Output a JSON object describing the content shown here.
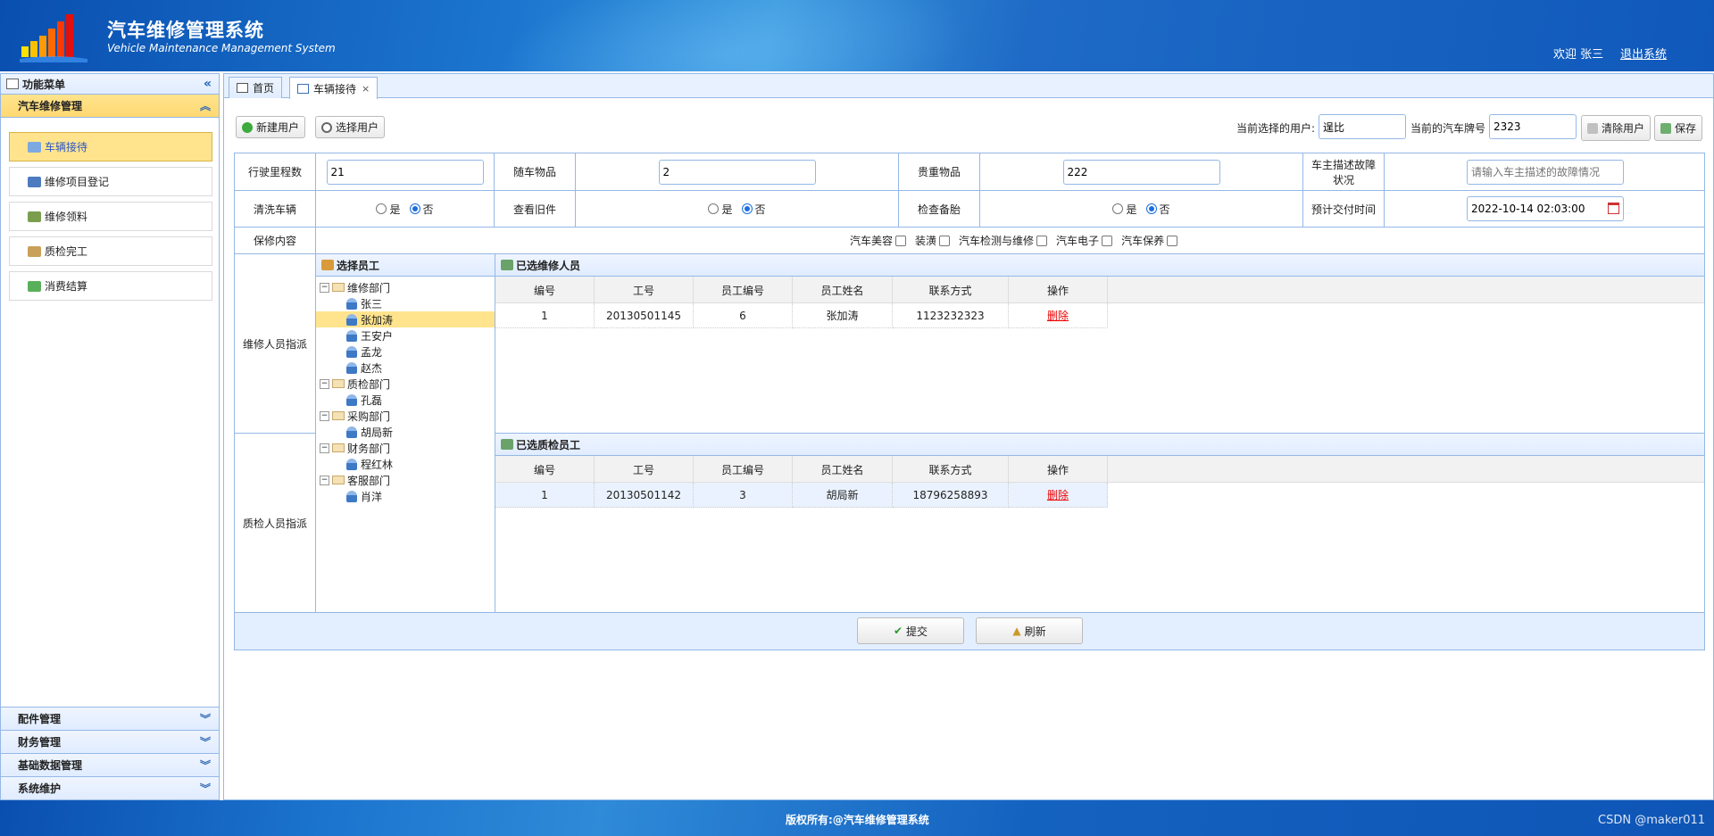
{
  "header": {
    "title": "汽车维修管理系统",
    "subtitle": "Vehicle Maintenance Management System",
    "welcome": "欢迎 张三",
    "logout": "退出系统"
  },
  "sidebar": {
    "title": "功能菜单",
    "active_group": "汽车维修管理",
    "items": [
      {
        "label": "车辆接待",
        "icon": "reception-icon"
      },
      {
        "label": "维修项目登记",
        "icon": "car-icon"
      },
      {
        "label": "维修领料",
        "icon": "materials-icon"
      },
      {
        "label": "质检完工",
        "icon": "inspection-icon"
      },
      {
        "label": "消费结算",
        "icon": "settlement-icon"
      }
    ],
    "other_groups": [
      "配件管理",
      "财务管理",
      "基础数据管理",
      "系统维护"
    ]
  },
  "tabs": [
    {
      "label": "首页"
    },
    {
      "label": "车辆接待",
      "closable": true
    }
  ],
  "toolbar": {
    "new_user": "新建用户",
    "select_user": "选择用户",
    "current_user_label": "当前选择的用户:",
    "current_user_value": "逞比",
    "current_plate_label": "当前的汽车牌号",
    "current_plate_value": "2323",
    "clear_user": "清除用户",
    "save": "保存"
  },
  "form": {
    "mileage_label": "行驶里程数",
    "mileage_value": "21",
    "items_label": "随车物品",
    "items_value": "2",
    "valuables_label": "贵重物品",
    "valuables_value": "222",
    "fault_label": "车主描述故障状况",
    "fault_placeholder": "请输入车主描述的故障情况",
    "clean_label": "清洗车辆",
    "oldparts_label": "查看旧件",
    "spare_label": "检查备胎",
    "yes": "是",
    "no": "否",
    "delivery_label": "预计交付时间",
    "delivery_value": "2022-10-14 02:03:00",
    "service_label": "保修内容",
    "services": [
      "汽车美容",
      "装潢",
      "汽车检测与维修",
      "汽车电子",
      "汽车保养"
    ],
    "repair_staff_label": "维修人员指派",
    "qc_staff_label": "质检人员指派"
  },
  "tree": {
    "title": "选择员工",
    "nodes": [
      {
        "label": "维修部门",
        "type": "dept"
      },
      {
        "label": "张三",
        "type": "person"
      },
      {
        "label": "张加涛",
        "type": "person",
        "selected": true
      },
      {
        "label": "王安户",
        "type": "person"
      },
      {
        "label": "孟龙",
        "type": "person"
      },
      {
        "label": "赵杰",
        "type": "person"
      },
      {
        "label": "质检部门",
        "type": "dept"
      },
      {
        "label": "孔磊",
        "type": "person"
      },
      {
        "label": "采购部门",
        "type": "dept"
      },
      {
        "label": "胡局新",
        "type": "person"
      },
      {
        "label": "财务部门",
        "type": "dept"
      },
      {
        "label": "程红林",
        "type": "person"
      },
      {
        "label": "客服部门",
        "type": "dept"
      },
      {
        "label": "肖洋",
        "type": "person"
      }
    ]
  },
  "repair_grid": {
    "title": "已选维修人员",
    "columns": [
      "编号",
      "工号",
      "员工编号",
      "员工姓名",
      "联系方式",
      "操作"
    ],
    "rows": [
      [
        "1",
        "20130501145",
        "6",
        "张加涛",
        "1123232323",
        "删除"
      ]
    ]
  },
  "qc_grid": {
    "title": "已选质检员工",
    "columns": [
      "编号",
      "工号",
      "员工编号",
      "员工姓名",
      "联系方式",
      "操作"
    ],
    "rows": [
      [
        "1",
        "20130501142",
        "3",
        "胡局新",
        "18796258893",
        "删除"
      ]
    ]
  },
  "actions": {
    "submit": "提交",
    "refresh": "刷新"
  },
  "footer": {
    "copyright": "版权所有:@汽车维修管理系统",
    "watermark": "CSDN @maker011"
  },
  "colors": {
    "header_blue": "#1565c0",
    "panel_border": "#95b8e7",
    "selected_yellow": "#ffe48d",
    "delete_red": "#e00000"
  }
}
